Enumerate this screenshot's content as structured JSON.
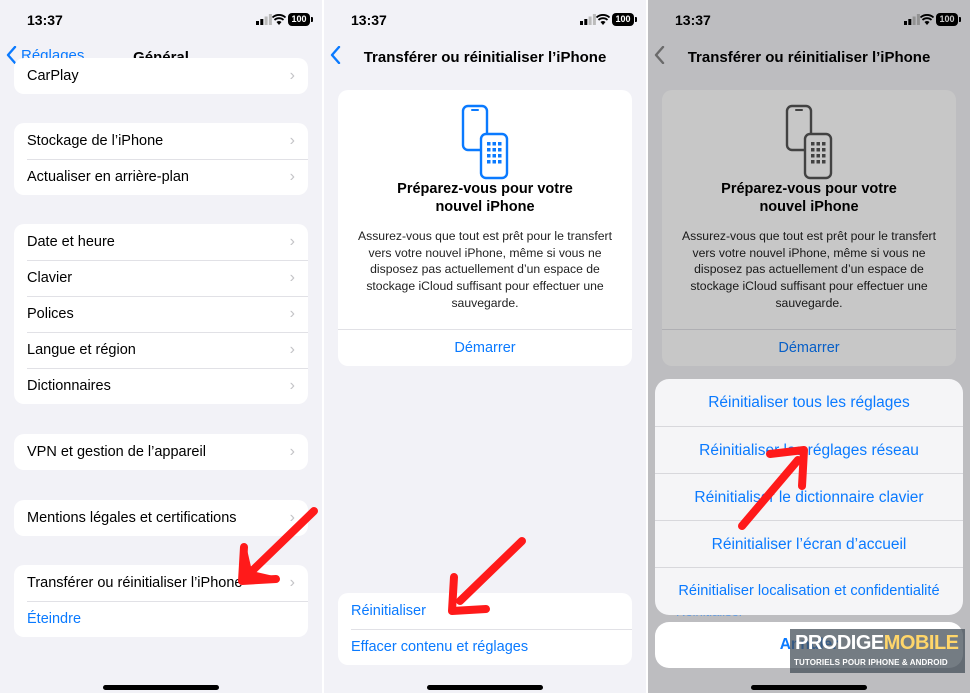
{
  "status": {
    "time": "13:37",
    "battery": "100"
  },
  "screen1": {
    "back_label": "Réglages",
    "title": "Général",
    "groups": [
      [
        "CarPlay"
      ],
      [
        "Stockage de l’iPhone",
        "Actualiser en arrière-plan"
      ],
      [
        "Date et heure",
        "Clavier",
        "Polices",
        "Langue et région",
        "Dictionnaires"
      ],
      [
        "VPN et gestion de l’appareil"
      ],
      [
        "Mentions légales et certifications"
      ]
    ],
    "transfer_label": "Transférer ou réinitialiser l’iPhone",
    "shutdown_label": "Éteindre"
  },
  "screen2": {
    "title": "Transférer ou réinitialiser l’iPhone",
    "card": {
      "heading_line1": "Préparez-vous pour votre",
      "heading_line2": "nouvel iPhone",
      "body": "Assurez-vous que tout est prêt pour le transfert vers votre nouvel iPhone, même si vous ne disposez pas actuellement d’un espace de stockage iCloud suffisant pour effectuer une sauvegarde.",
      "start_label": "Démarrer"
    },
    "reset_label": "Réinitialiser",
    "erase_label": "Effacer contenu et réglages"
  },
  "screen3": {
    "options": [
      "Réinitialiser tous les réglages",
      "Réinitialiser les réglages réseau",
      "Réinitialiser le dictionnaire clavier",
      "Réinitialiser l’écran d’accueil",
      "Réinitialiser localisation et confidentialité"
    ],
    "cancel_label": "Annuler",
    "peek_label": "Réinitialiser"
  },
  "watermark": {
    "brand_part1": "PRODIGE",
    "brand_part2": "MOBILE",
    "tagline": "TUTORIELS POUR IPHONE & ANDROID"
  },
  "colors": {
    "accent": "#0a7aff",
    "arrow": "#ff1a1a",
    "background": "#f2f2f7"
  },
  "icons": [
    "chevron-left-icon",
    "chevron-right-icon",
    "cellular-signal-icon",
    "wifi-icon",
    "battery-icon",
    "transfer-phones-icon",
    "red-arrow-icon"
  ]
}
